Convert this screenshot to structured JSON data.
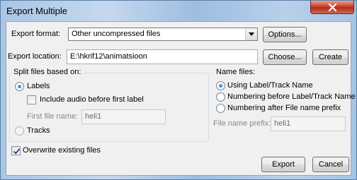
{
  "window": {
    "title": "Export Multiple"
  },
  "export_format": {
    "label": "Export format:",
    "selected": "Other uncompressed files",
    "options_button": "Options..."
  },
  "export_location": {
    "label": "Export location:",
    "value": "E:\\hkrif12\\animatsioon",
    "choose_button": "Choose...",
    "create_button": "Create"
  },
  "split": {
    "title": "Split files based on:",
    "labels_option": "Labels",
    "labels_checked": true,
    "include_audio_label": "Include audio before first label",
    "include_audio_checked": false,
    "first_file_name_label": "First file name:",
    "first_file_name_value": "heli1",
    "tracks_option": "Tracks",
    "tracks_checked": false
  },
  "name_files": {
    "title": "Name files:",
    "options": [
      {
        "label": "Using Label/Track Name",
        "checked": true
      },
      {
        "label": "Numbering before Label/Track Name",
        "checked": false
      },
      {
        "label": "Numbering after File name prefix",
        "checked": false
      }
    ],
    "prefix_label": "File name prefix:",
    "prefix_value": "heli1"
  },
  "overwrite": {
    "label": "Overwrite existing files",
    "checked": true
  },
  "buttons": {
    "export": "Export",
    "cancel": "Cancel"
  }
}
